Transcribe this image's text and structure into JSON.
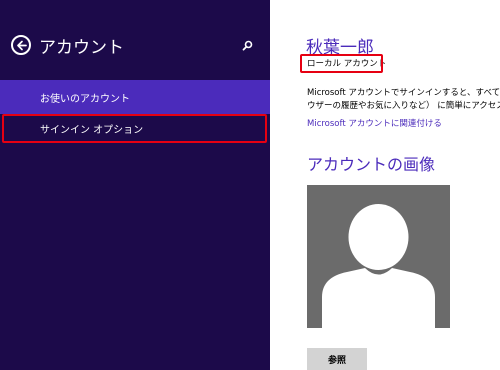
{
  "sidebar": {
    "title": "アカウント",
    "back_icon": "back-arrow-icon",
    "search_icon": "search-icon",
    "items": [
      {
        "label": "お使いのアカウント",
        "selected": true
      },
      {
        "label": "サインイン オプション",
        "selected": false
      }
    ],
    "background_color": "#1c0a4a",
    "selected_color": "#4b2bbb"
  },
  "main": {
    "user_name": "秋葉一郎",
    "account_type": "ローカル アカウント",
    "description_line1": "Microsoft アカウントでサインインすると、すべてのデ",
    "description_line2": "ウザーの履歴やお気に入りなど） に簡単にアクセスで",
    "link_text": "Microsoft アカウントに関連付ける",
    "picture_section_title": "アカウントの画像",
    "avatar_icon": "user-silhouette-icon",
    "browse_button": "参照",
    "accent_color": "#4b2bbb"
  },
  "annotations": {
    "highlight_color": "#e60012"
  }
}
